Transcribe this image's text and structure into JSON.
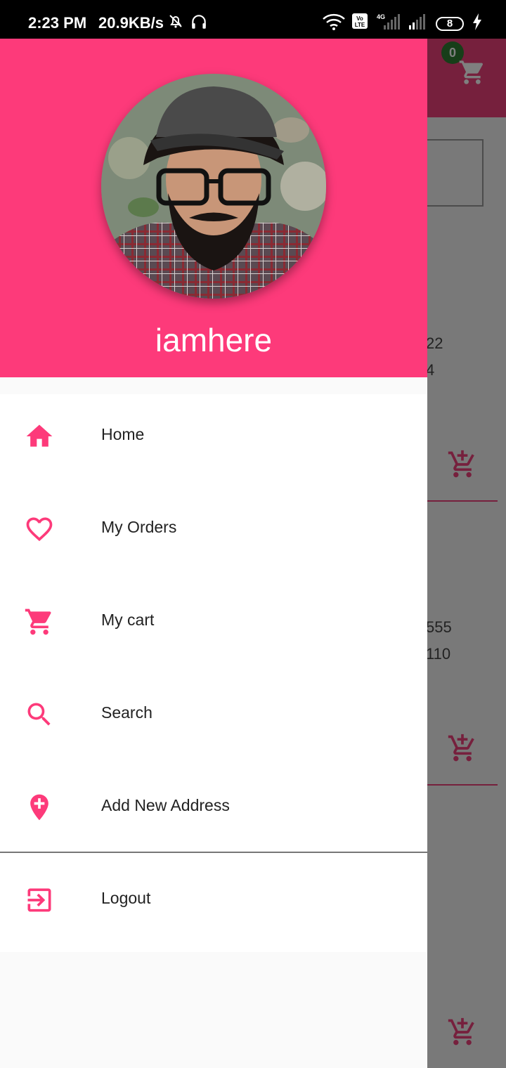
{
  "status_bar": {
    "time": "2:23 PM",
    "net_speed": "20.9KB/s",
    "battery": "8",
    "icons": [
      "mute-bell-icon",
      "headphones-icon",
      "wifi-icon",
      "volte-icon",
      "signal-icon",
      "signal-icon-2",
      "battery-icon",
      "charging-icon"
    ]
  },
  "background": {
    "cart_badge": "0",
    "price_1a": "22",
    "price_1b": "4",
    "price_2a": "555",
    "price_2b": "110"
  },
  "drawer": {
    "username": "iamhere",
    "menu": [
      {
        "label": "Home",
        "icon": "home-icon"
      },
      {
        "label": "My Orders",
        "icon": "heart-icon"
      },
      {
        "label": "My cart",
        "icon": "cart-icon"
      },
      {
        "label": "Search",
        "icon": "search-icon"
      },
      {
        "label": "Add New Address",
        "icon": "add-location-icon"
      },
      {
        "label": "Logout",
        "icon": "logout-icon"
      }
    ]
  },
  "colors": {
    "accent": "#fd3a7a",
    "badge": "#2e7d32"
  }
}
